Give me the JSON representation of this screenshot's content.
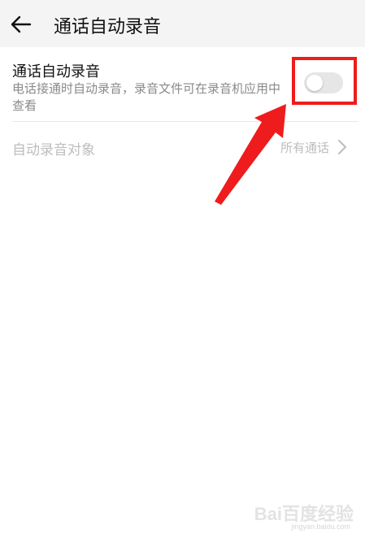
{
  "appbar": {
    "title": "通话自动录音",
    "back_icon": "arrow-left-icon"
  },
  "auto_record": {
    "title": "通话自动录音",
    "description": "电话接通时自动录音，录音文件可在录音机应用中查看",
    "toggle_state": "off"
  },
  "record_target": {
    "label": "自动录音对象",
    "value": "所有通话",
    "icon": "chevron-right-icon"
  },
  "annotation": {
    "color": "#ee1c1c",
    "highlight": "toggle",
    "arrow": "red-arrow"
  },
  "watermark": {
    "main": "Bai百度经验",
    "sub": "jingyan.baidu.com"
  },
  "colors": {
    "appbar_bg": "#f4f4f4",
    "primary_text": "#111111",
    "secondary_text": "#8a8a8a",
    "disabled_text": "#bdbdbd",
    "toggle_off": "#e6e6e6"
  }
}
